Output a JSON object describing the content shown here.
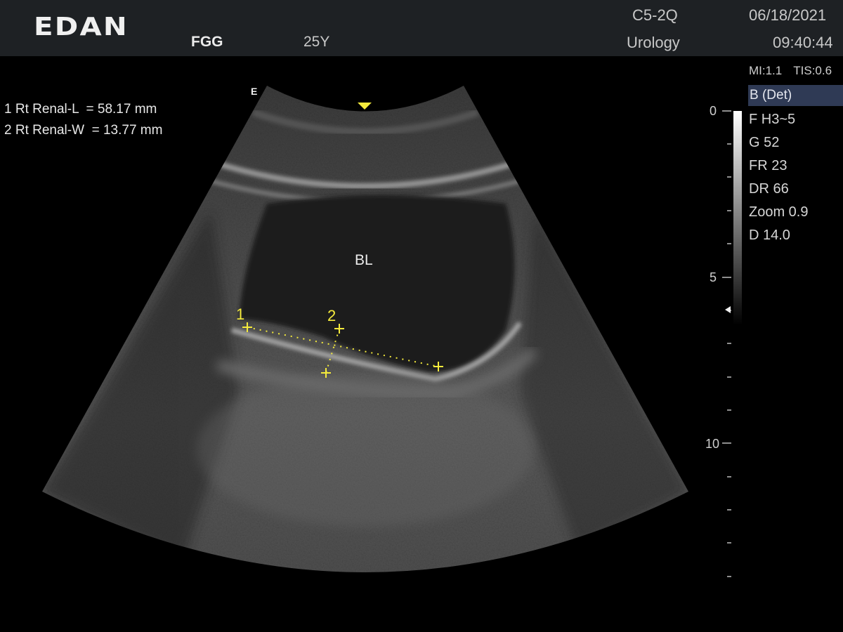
{
  "header": {
    "logo": "EDAN",
    "patient_name": "FGG",
    "patient_age": "25Y",
    "probe": "C5-2Q",
    "preset": "Urology",
    "date": "06/18/2021",
    "time": "09:40:44"
  },
  "safety": {
    "mi": "MI:1.1",
    "tis": "TIS:0.6"
  },
  "mode": "B (Det)",
  "params": [
    "F H3~5",
    "G 52",
    "FR 23",
    "DR 66",
    "Zoom 0.9",
    "D 14.0"
  ],
  "measurements": [
    "1 Rt Renal-L  = 58.17 mm",
    "2 Rt Renal-W  = 13.77 mm"
  ],
  "image": {
    "orientation_marker": "E",
    "organ_label": "BL",
    "caliper_1_label": "1",
    "caliper_2_label": "2"
  },
  "depth_scale": {
    "label_0": "0",
    "label_5": "5",
    "label_10": "10"
  },
  "colors": {
    "caliper": "#f4ea3c",
    "header_bg": "#1e2124",
    "mode_badge_bg": "#2f3a55"
  }
}
